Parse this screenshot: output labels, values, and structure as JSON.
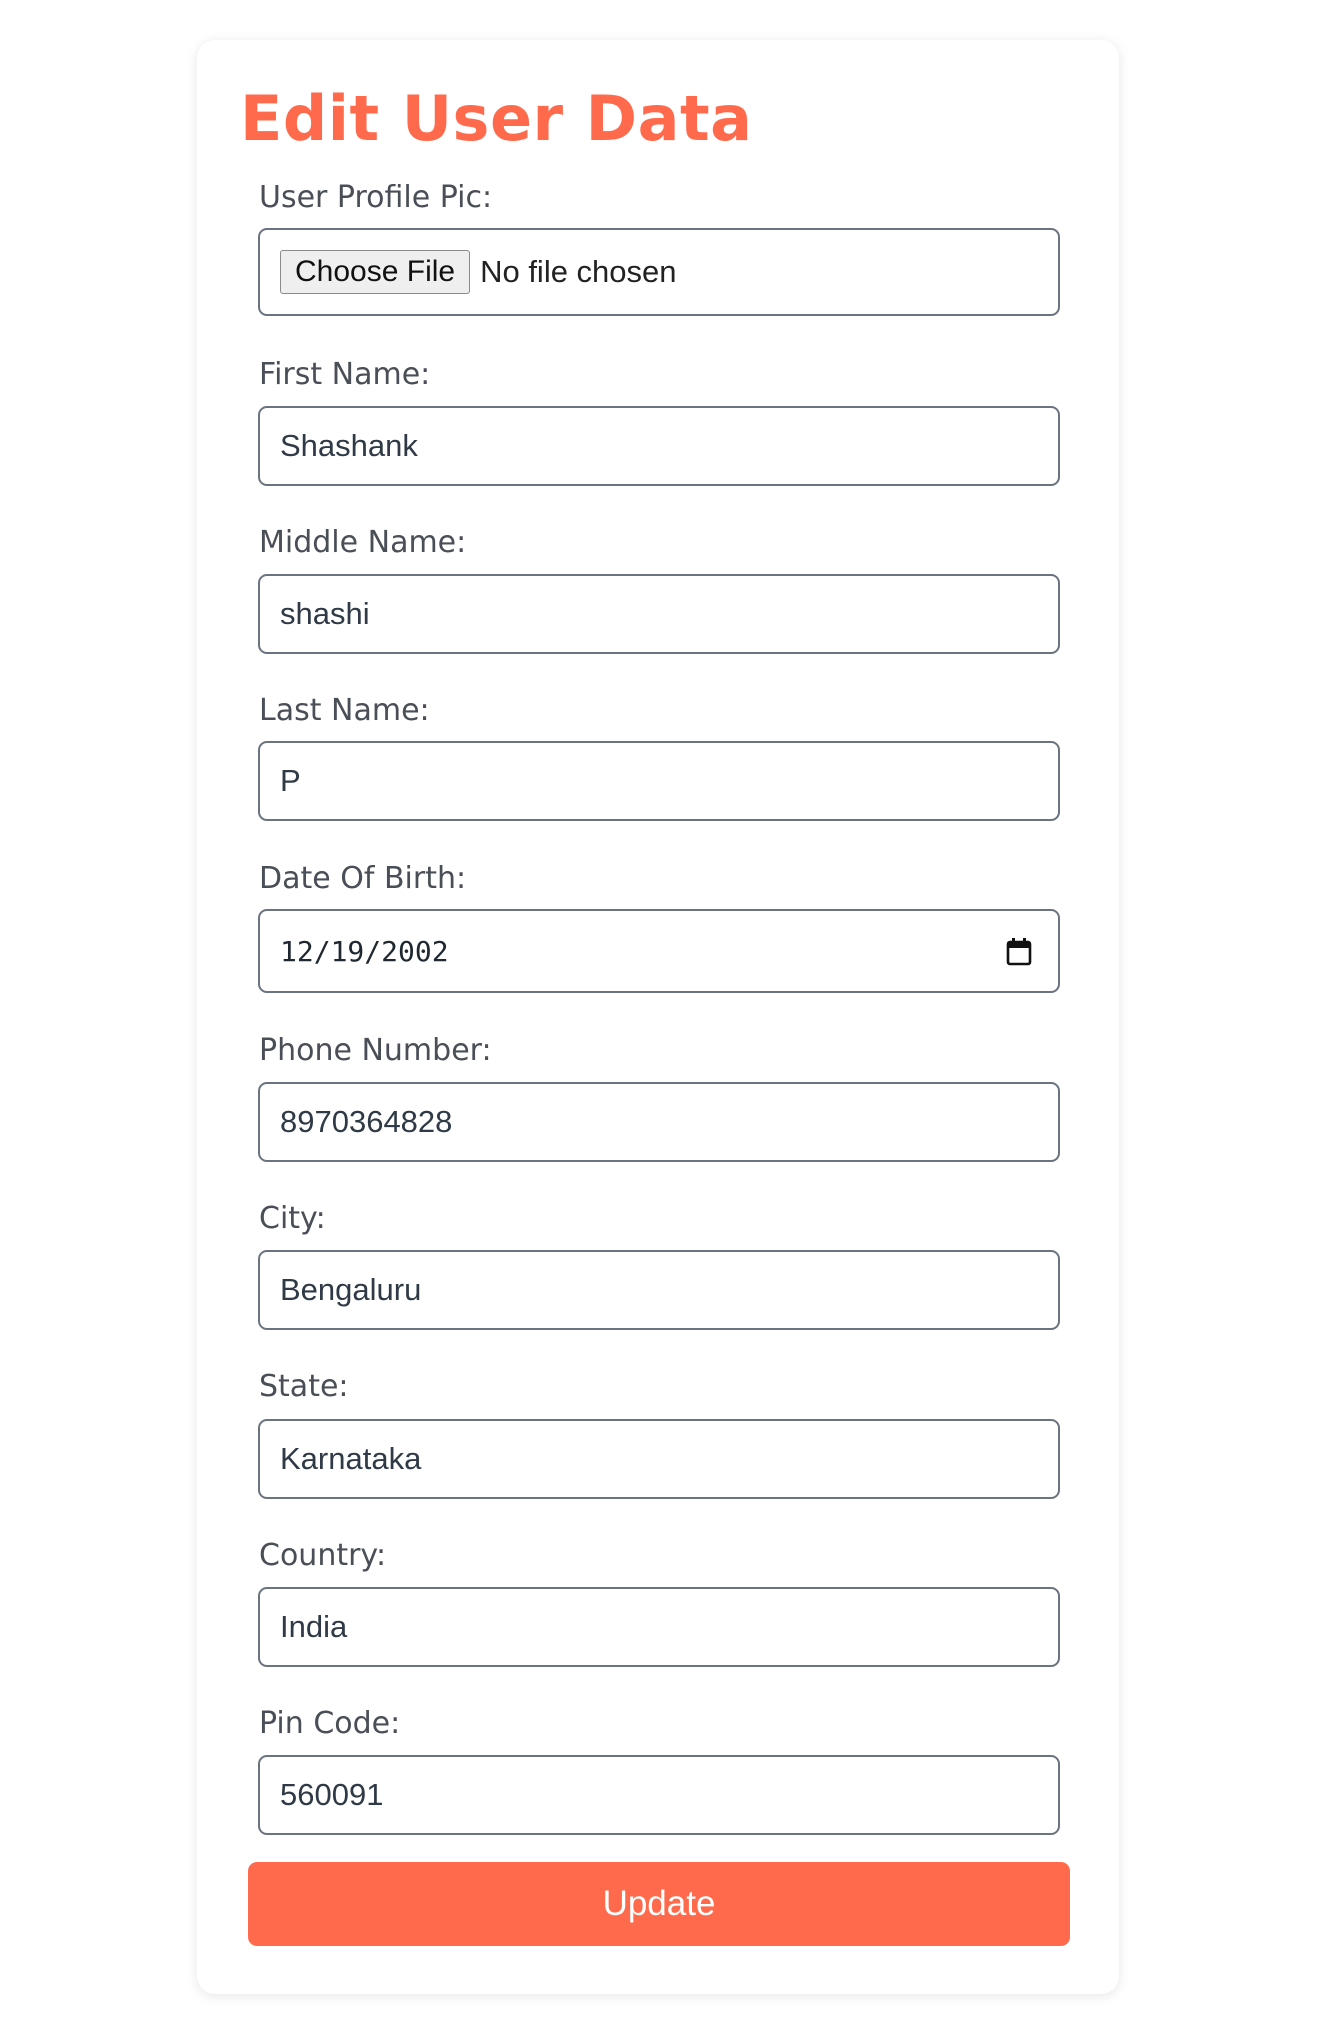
{
  "title": "Edit User Data",
  "fields": {
    "profile_pic": {
      "label": "User Profile Pic:",
      "button": "Choose File",
      "status": "No file chosen"
    },
    "first_name": {
      "label": "First Name:",
      "value": "Shashank"
    },
    "middle_name": {
      "label": "Middle Name:",
      "value": "shashi"
    },
    "last_name": {
      "label": "Last Name:",
      "value": "P"
    },
    "dob": {
      "label": "Date Of Birth:",
      "value": "12/19/2002",
      "icon": "calendar-icon"
    },
    "phone": {
      "label": "Phone Number:",
      "value": "8970364828"
    },
    "city": {
      "label": "City:",
      "value": "Bengaluru"
    },
    "state": {
      "label": "State:",
      "value": "Karnataka"
    },
    "country": {
      "label": "Country:",
      "value": "India"
    },
    "pin": {
      "label": "Pin Code:",
      "value": "560091"
    }
  },
  "submit_label": "Update",
  "colors": {
    "accent": "#ff6a4d",
    "border": "#6a7380",
    "label": "#4a4f57"
  }
}
